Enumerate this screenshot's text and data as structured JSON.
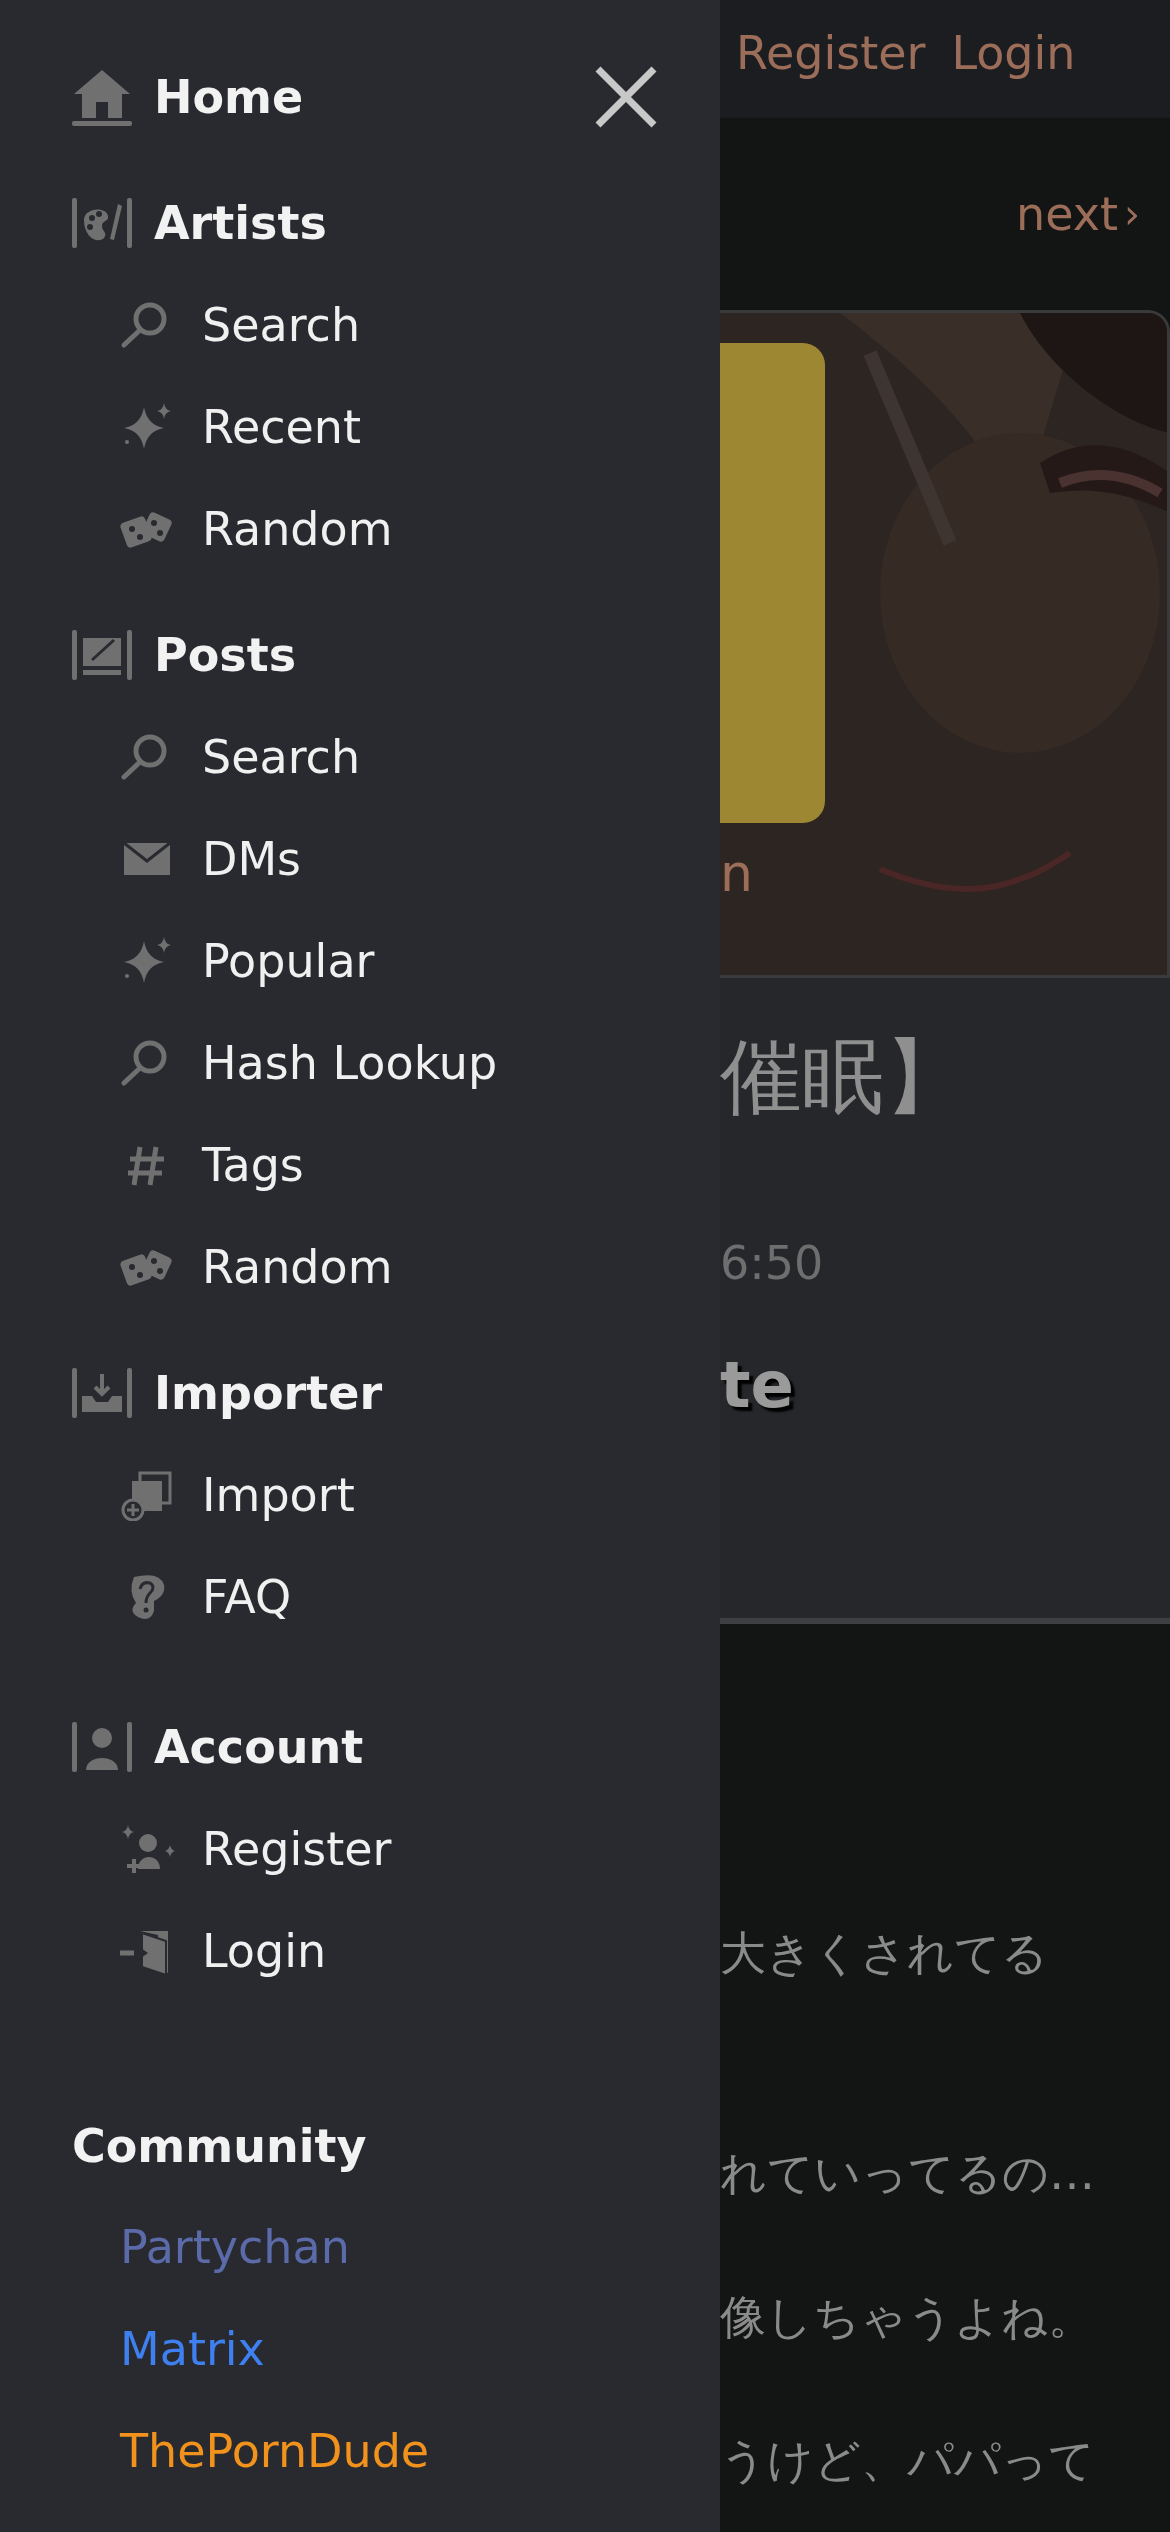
{
  "sidebar": {
    "sections": [
      {
        "kind": "group",
        "heading": "Home"
      },
      {
        "kind": "group",
        "heading": "Artists",
        "items": [
          {
            "label": "Search"
          },
          {
            "label": "Recent"
          },
          {
            "label": "Random"
          }
        ]
      },
      {
        "kind": "group",
        "heading": "Posts",
        "items": [
          {
            "label": "Search"
          },
          {
            "label": "DMs"
          },
          {
            "label": "Popular"
          },
          {
            "label": "Hash Lookup"
          },
          {
            "label": "Tags"
          },
          {
            "label": "Random"
          }
        ]
      },
      {
        "kind": "group",
        "heading": "Importer",
        "items": [
          {
            "label": "Import"
          },
          {
            "label": "FAQ"
          }
        ]
      },
      {
        "kind": "group",
        "heading": "Account",
        "items": [
          {
            "label": "Register"
          },
          {
            "label": "Login"
          }
        ]
      },
      {
        "kind": "links",
        "heading": "Community",
        "items": [
          {
            "label": "Partychan",
            "color": "#5b6aa8"
          },
          {
            "label": "Matrix",
            "color": "#3f80f0"
          },
          {
            "label": "ThePornDude",
            "color": "#f0921c"
          }
        ]
      }
    ]
  },
  "page": {
    "nav_links": [
      "Register",
      "Login"
    ],
    "next_link": "next",
    "next_arrow": "›",
    "image_caption": "n",
    "title": "催眠】",
    "time": "6:50",
    "heading": "te",
    "body_lines": [
      "大きくされてる",
      "れていってるの…",
      "像しちゃうよね。",
      "うけど、パパって"
    ]
  }
}
